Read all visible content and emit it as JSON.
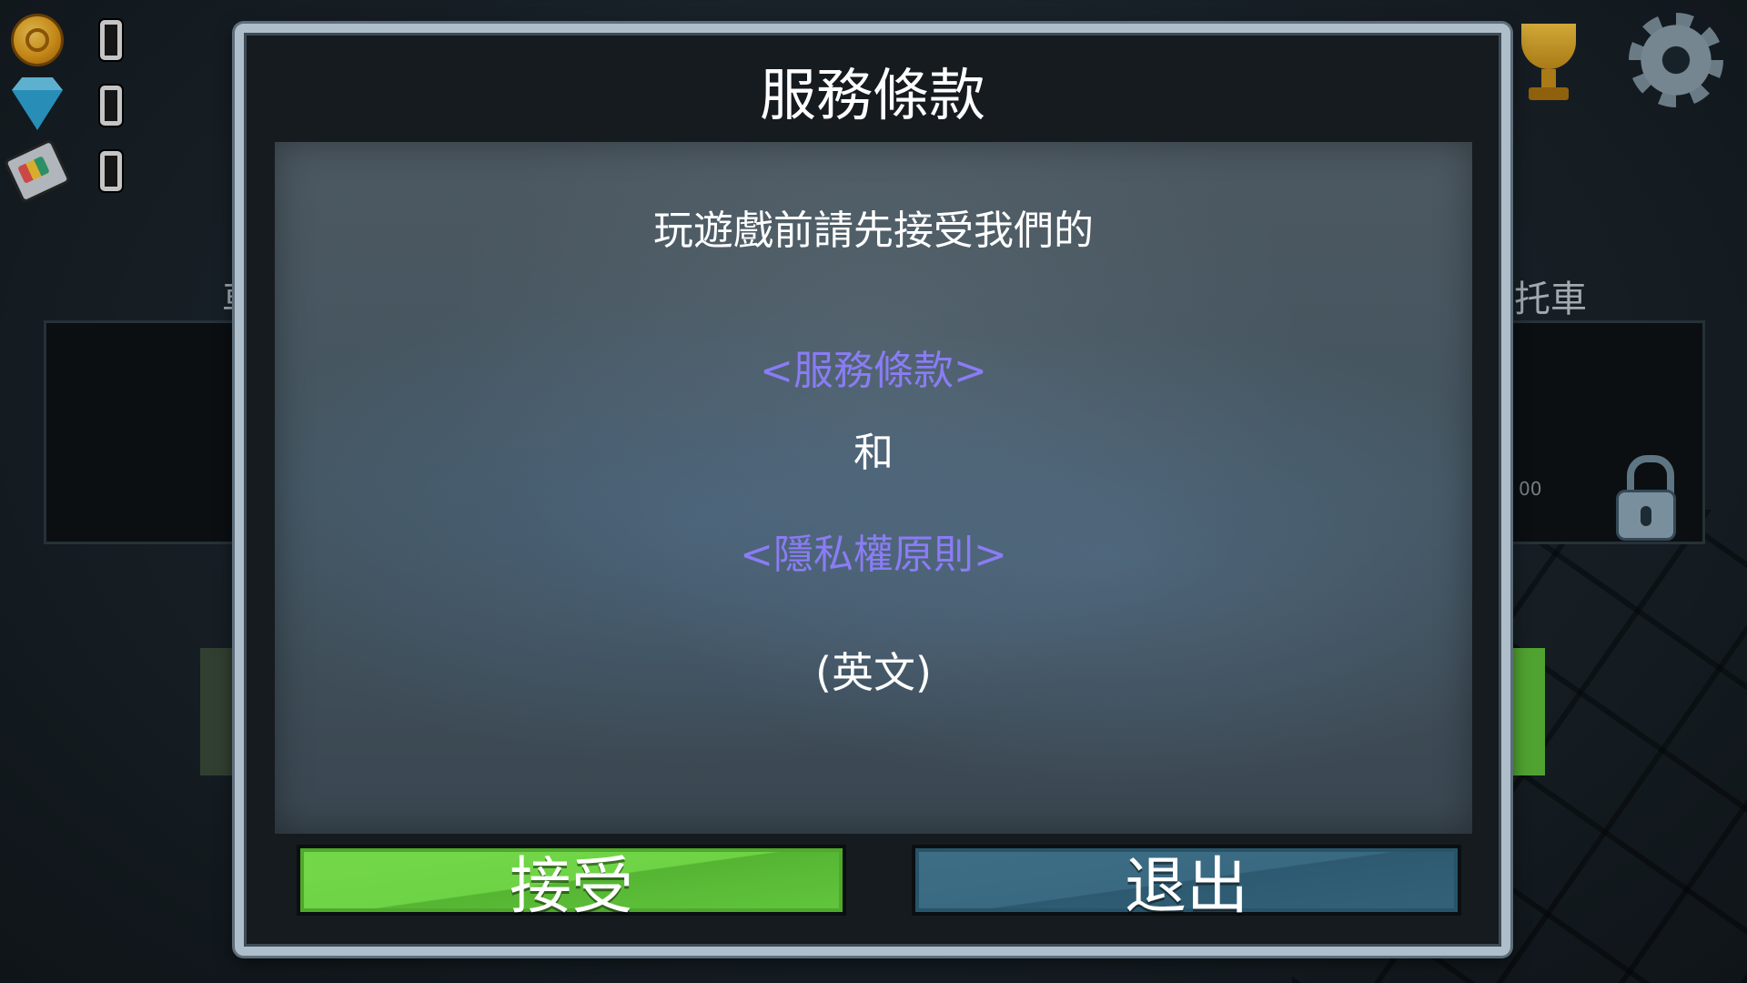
{
  "hud": {
    "items": [
      {
        "icon": "coin-icon",
        "count": "0"
      },
      {
        "icon": "gem-icon",
        "count": "0"
      },
      {
        "icon": "paint-can-icon",
        "count": "0"
      }
    ]
  },
  "background": {
    "left_label": "車",
    "right_label": "托車",
    "right_card_value": "00"
  },
  "dialog": {
    "title": "服務條款",
    "intro": "玩遊戲前請先接受我們的",
    "tos_link": "<服務條款>",
    "and": "和",
    "privacy_link": "<隱私權原則>",
    "language_note": "(英文)",
    "accept_label": "接受",
    "exit_label": "退出"
  },
  "colors": {
    "link": "#8a7cf5",
    "accept": "#6ed445",
    "exit": "#3a6a82"
  }
}
